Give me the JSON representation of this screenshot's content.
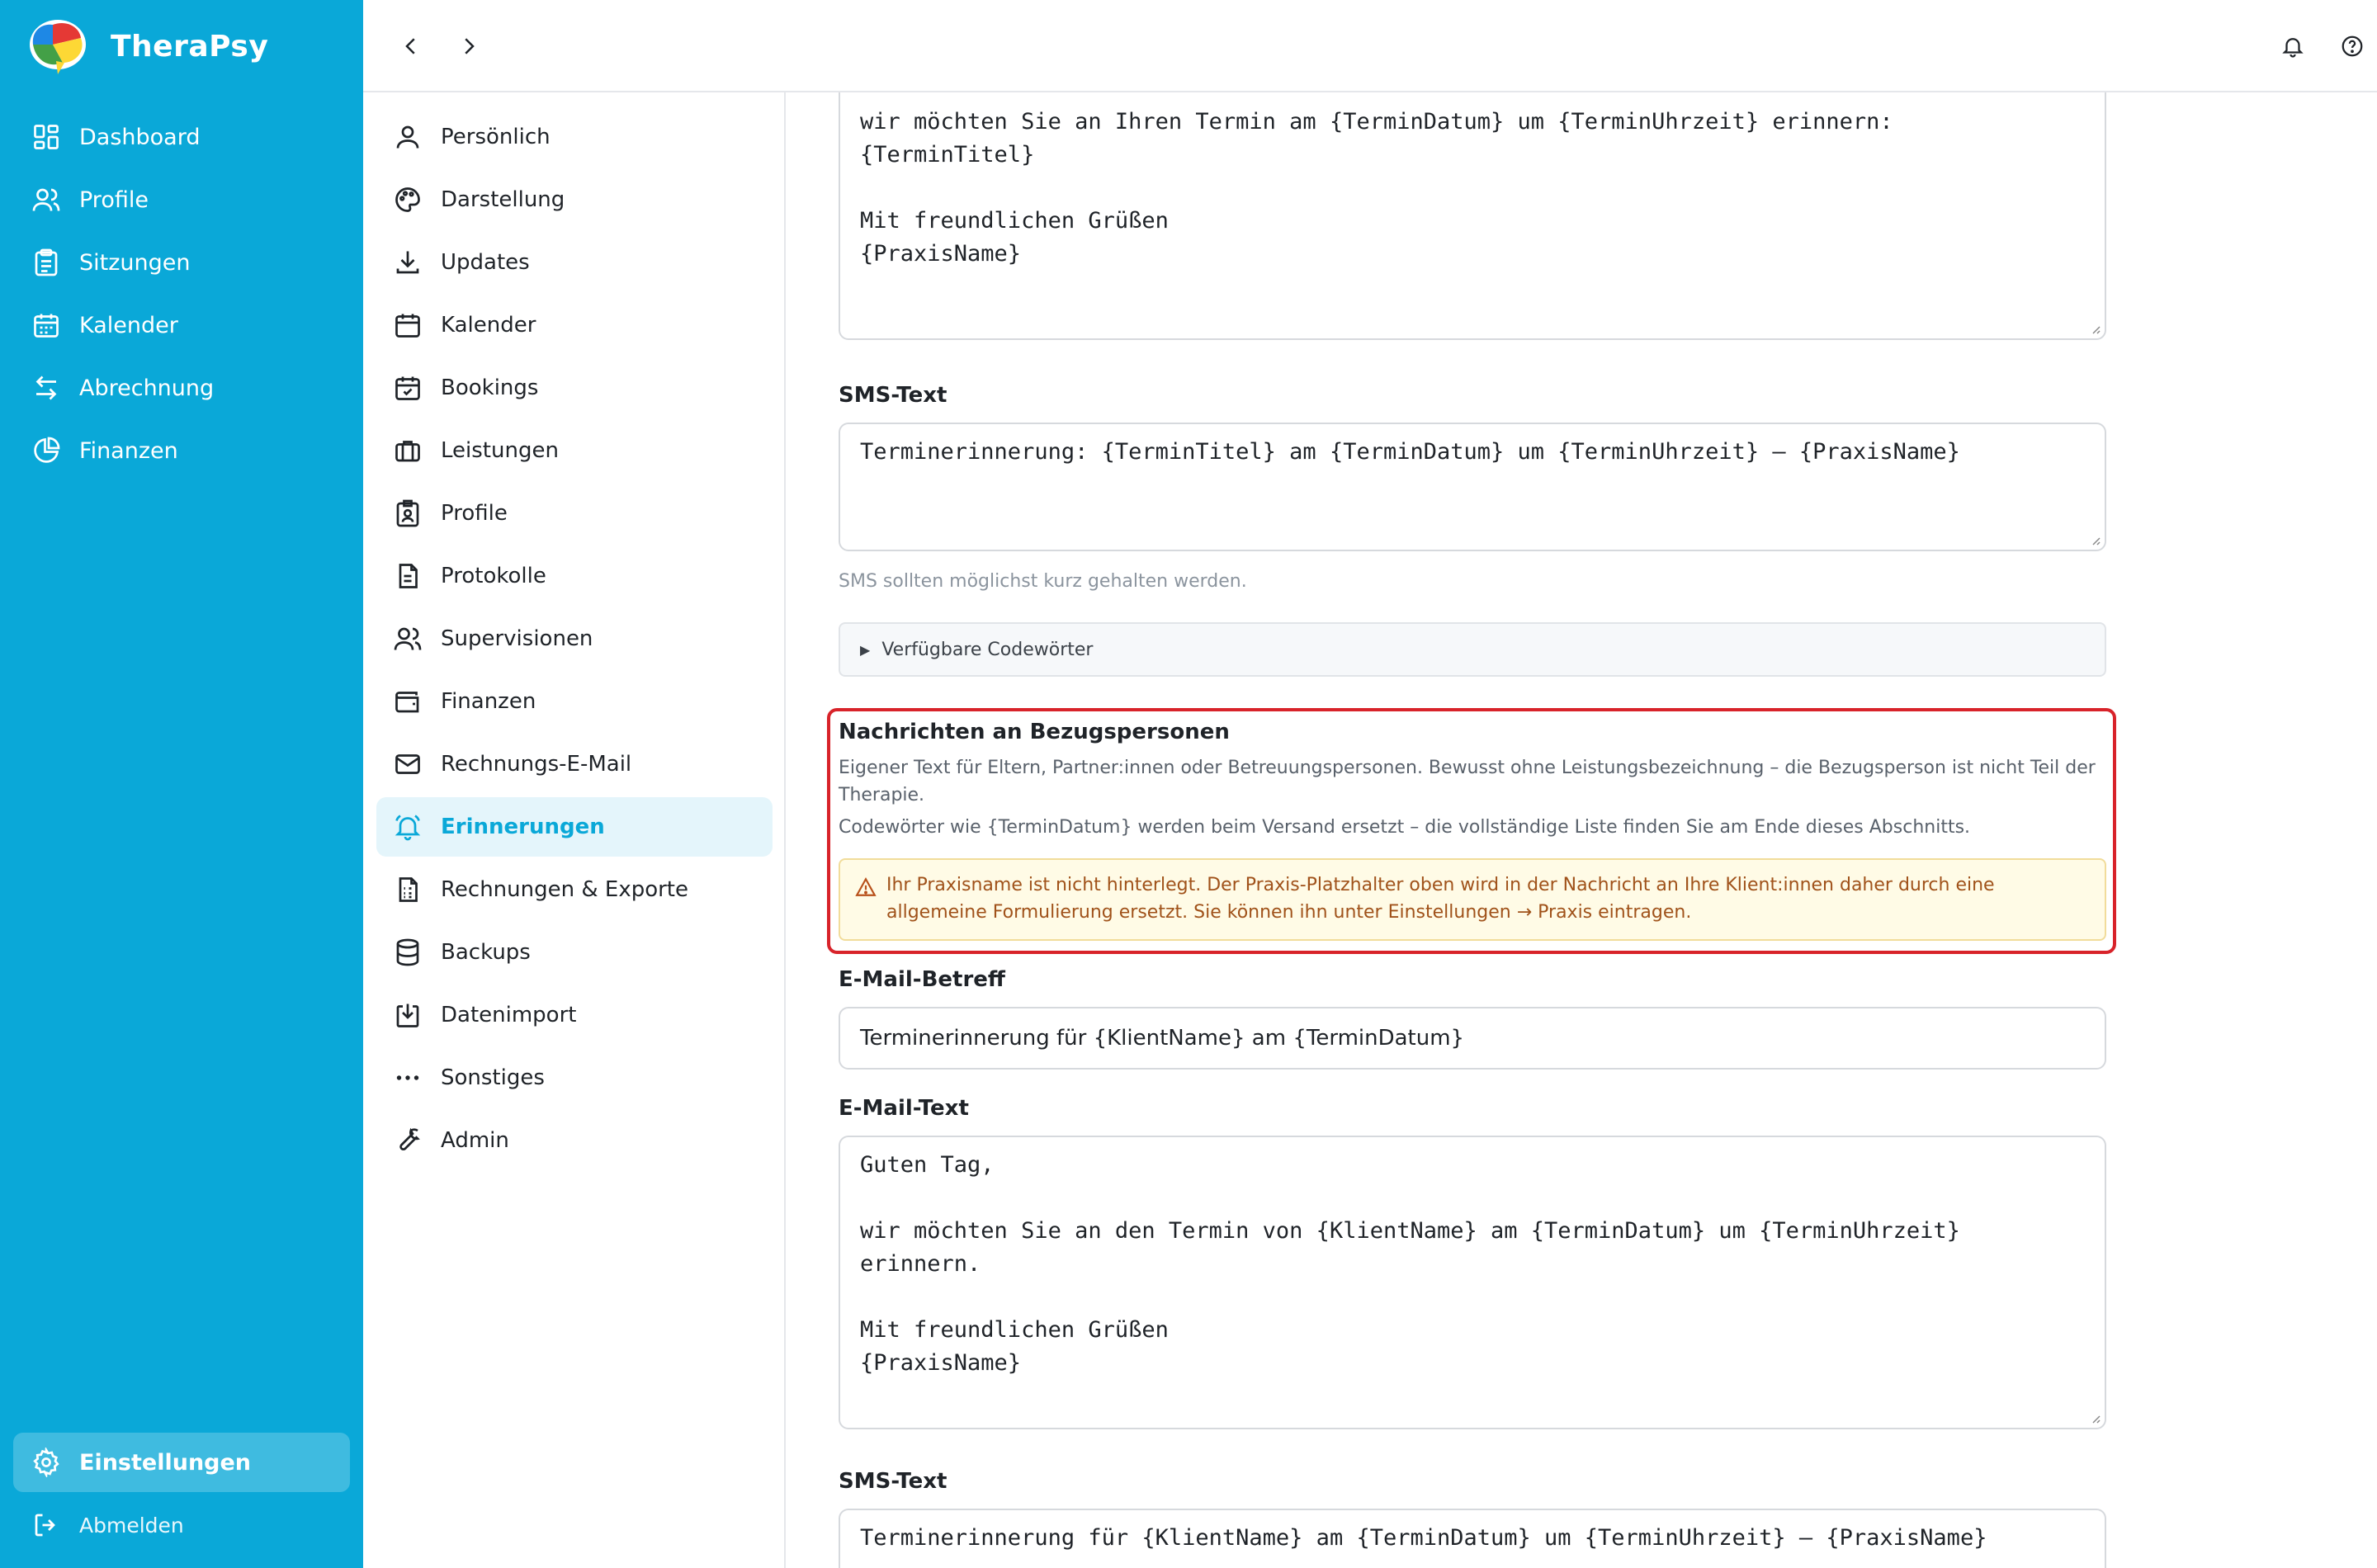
{
  "app": {
    "name": "TheraPsy"
  },
  "nav": {
    "items": [
      {
        "label": "Dashboard",
        "icon": "dashboard-icon"
      },
      {
        "label": "Profile",
        "icon": "users-icon"
      },
      {
        "label": "Sitzungen",
        "icon": "clipboard-icon"
      },
      {
        "label": "Kalender",
        "icon": "calendar-icon"
      },
      {
        "label": "Abrechnung",
        "icon": "arrows-icon"
      },
      {
        "label": "Finanzen",
        "icon": "pie-chart-icon"
      }
    ],
    "settings_label": "Einstellungen",
    "logout_label": "Abmelden"
  },
  "settings_nav": {
    "items": [
      {
        "label": "Persönlich"
      },
      {
        "label": "Darstellung"
      },
      {
        "label": "Updates"
      },
      {
        "label": "Kalender"
      },
      {
        "label": "Bookings"
      },
      {
        "label": "Leistungen"
      },
      {
        "label": "Profile"
      },
      {
        "label": "Protokolle"
      },
      {
        "label": "Supervisionen"
      },
      {
        "label": "Finanzen"
      },
      {
        "label": "Rechnungs-E-Mail"
      },
      {
        "label": "Erinnerungen"
      },
      {
        "label": "Rechnungen & Exporte"
      },
      {
        "label": "Backups"
      },
      {
        "label": "Datenimport"
      },
      {
        "label": "Sonstiges"
      },
      {
        "label": "Admin"
      }
    ],
    "active": "Erinnerungen"
  },
  "main": {
    "client_email_text_tail": "wir möchten Sie an Ihren Termin am {TerminDatum} um {TerminUhrzeit} erinnern:\n{TerminTitel}\n\nMit freundlichen Grüßen\n{PraxisName}",
    "client_sms_label": "SMS-Text",
    "client_sms_text": "Terminerinnerung: {TerminTitel} am {TerminDatum} um {TerminUhrzeit} – {PraxisName}",
    "sms_hint": "SMS sollten möglichst kurz gehalten werden.",
    "codewords_label": "Verfügbare Codewörter",
    "ref_section": {
      "title": "Nachrichten an Bezugspersonen",
      "desc1": "Eigener Text für Eltern, Partner:innen oder Betreuungspersonen. Bewusst ohne Leistungsbezeichnung – die Bezugsperson ist nicht Teil der Therapie.",
      "desc2": "Codewörter wie {TerminDatum} werden beim Versand ersetzt – die vollständige Liste finden Sie am Ende dieses Abschnitts.",
      "warning": "Ihr Praxisname ist nicht hinterlegt. Der Praxis-Platzhalter oben wird in der Nachricht an Ihre Klient:innen daher durch eine allgemeine Formulierung ersetzt. Sie können ihn unter Einstellungen → Praxis eintragen."
    },
    "ref_email_subject_label": "E-Mail-Betreff",
    "ref_email_subject": "Terminerinnerung für {KlientName} am {TerminDatum}",
    "ref_email_text_label": "E-Mail-Text",
    "ref_email_text": "Guten Tag,\n\nwir möchten Sie an den Termin von {KlientName} am {TerminDatum} um {TerminUhrzeit}\nerinnern.\n\nMit freundlichen Grüßen\n{PraxisName}",
    "ref_sms_label": "SMS-Text",
    "ref_sms_text": "Terminerinnerung für {KlientName} am {TerminDatum} um {TerminUhrzeit} – {PraxisName}"
  },
  "colors": {
    "brand": "#0aa8d8",
    "highlight": "#d8232a",
    "warning_bg": "#fffbe6",
    "warning_text": "#a0521a"
  }
}
